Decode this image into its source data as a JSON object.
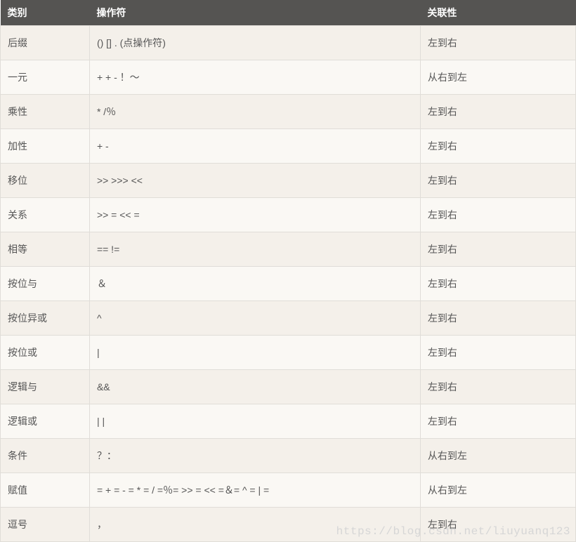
{
  "headers": {
    "category": "类别",
    "operator": "操作符",
    "associativity": "关联性"
  },
  "rows": [
    {
      "category": "后缀",
      "operator": "() [] . (点操作符)",
      "associativity": "左到右"
    },
    {
      "category": "一元",
      "operator": "+ + - ！〜",
      "associativity": "从右到左"
    },
    {
      "category": "乘性",
      "operator": "* /％",
      "associativity": "左到右"
    },
    {
      "category": "加性",
      "operator": "+ -",
      "associativity": "左到右"
    },
    {
      "category": "移位",
      "operator": ">> >>>  <<",
      "associativity": "左到右"
    },
    {
      "category": "关系",
      "operator": ">> = << =",
      "associativity": "左到右"
    },
    {
      "category": "相等",
      "operator": "==  !=",
      "associativity": "左到右"
    },
    {
      "category": "按位与",
      "operator": "＆",
      "associativity": "左到右"
    },
    {
      "category": "按位异或",
      "operator": "^",
      "associativity": "左到右"
    },
    {
      "category": "按位或",
      "operator": "|",
      "associativity": "左到右"
    },
    {
      "category": "逻辑与",
      "operator": "&&",
      "associativity": "左到右"
    },
    {
      "category": "逻辑或",
      "operator": "| |",
      "associativity": "左到右"
    },
    {
      "category": "条件",
      "operator": "？：",
      "associativity": "从右到左"
    },
    {
      "category": "赋值",
      "operator": "= + = - = * = / =％= >> = << =＆= ^ = | =",
      "associativity": "从右到左"
    },
    {
      "category": "逗号",
      "operator": "，",
      "associativity": "左到右"
    }
  ],
  "watermark": "https://blog.csdn.net/liuyuanq123",
  "chart_data": {
    "type": "table",
    "columns": [
      "类别",
      "操作符",
      "关联性"
    ],
    "rows": [
      [
        "后缀",
        "() [] . (点操作符)",
        "左到右"
      ],
      [
        "一元",
        "+ + - ！〜",
        "从右到左"
      ],
      [
        "乘性",
        "* /％",
        "左到右"
      ],
      [
        "加性",
        "+ -",
        "左到右"
      ],
      [
        "移位",
        ">> >>>  <<",
        "左到右"
      ],
      [
        "关系",
        ">> = << =",
        "左到右"
      ],
      [
        "相等",
        "==  !=",
        "左到右"
      ],
      [
        "按位与",
        "＆",
        "左到右"
      ],
      [
        "按位异或",
        "^",
        "左到右"
      ],
      [
        "按位或",
        "|",
        "左到右"
      ],
      [
        "逻辑与",
        "&&",
        "左到右"
      ],
      [
        "逻辑或",
        "| |",
        "左到右"
      ],
      [
        "条件",
        "？：",
        "从右到左"
      ],
      [
        "赋值",
        "= + = - = * = / =％= >> = << =＆= ^ = | =",
        "从右到左"
      ],
      [
        "逗号",
        "，",
        "左到右"
      ]
    ]
  }
}
